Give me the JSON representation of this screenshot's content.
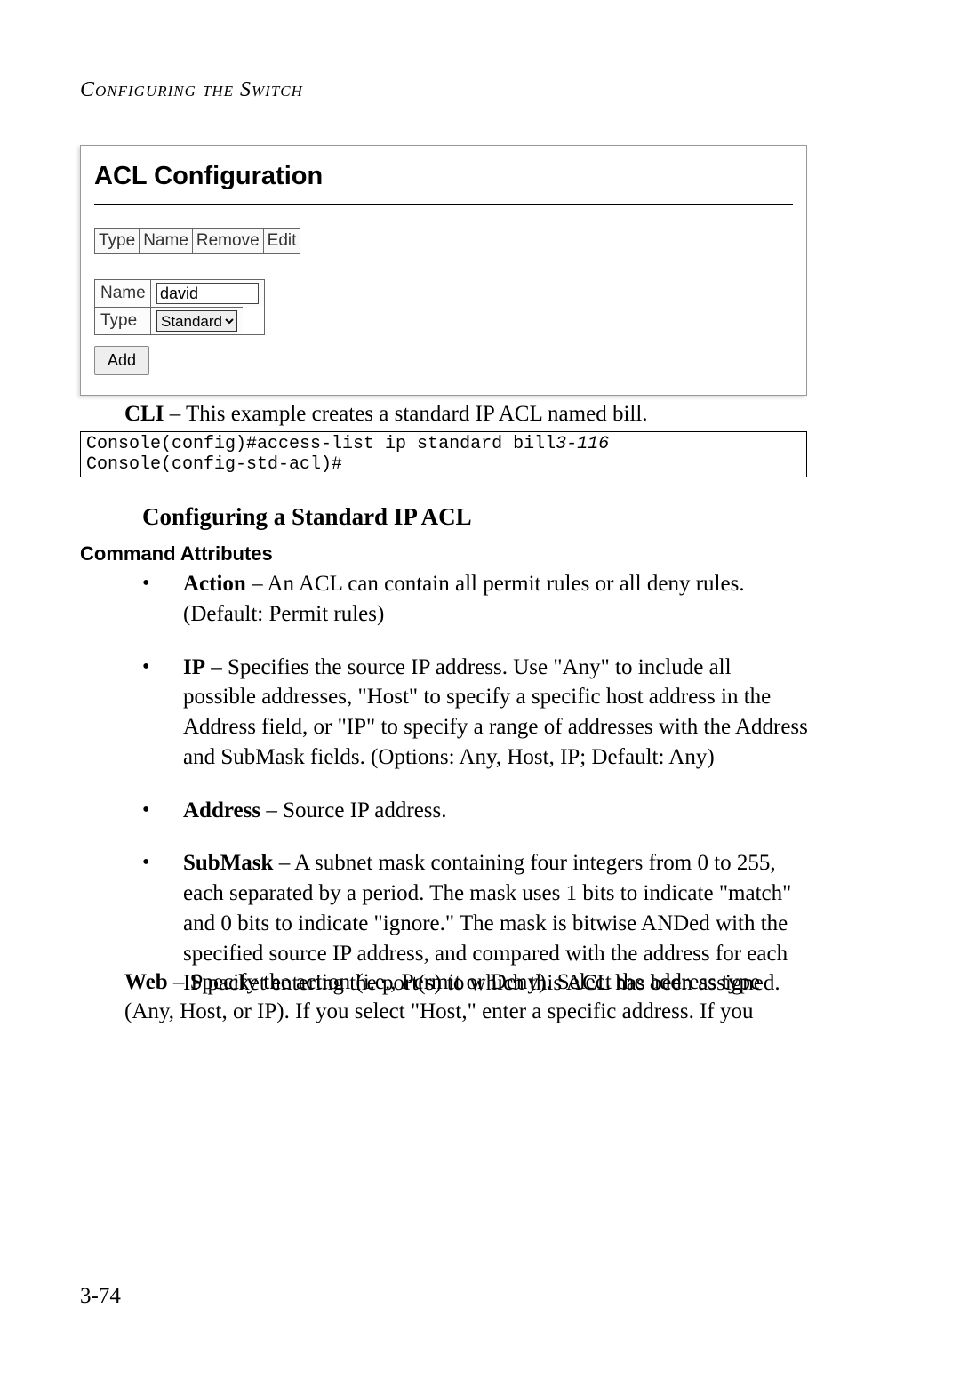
{
  "header": {
    "title": "Configuring the Switch"
  },
  "panel": {
    "title": "ACL Configuration",
    "table_columns": [
      "Type",
      "Name",
      "Remove",
      "Edit"
    ],
    "form": {
      "name_label": "Name",
      "name_value": "david",
      "type_label": "Type",
      "type_value": "Standard",
      "type_options": [
        "Standard"
      ]
    },
    "add_button": "Add"
  },
  "cli": {
    "prefix": "CLI",
    "text": " – This example creates a standard IP ACL named bill."
  },
  "code": {
    "line1_cmd": "Console(config)#access-list ip standard bill",
    "line1_ref": "3-116",
    "line2": "Console(config-std-acl)#"
  },
  "subheading": "Configuring a Standard IP ACL",
  "cmd_attr_label": "Command Attributes",
  "bullets": [
    {
      "term": "Action",
      "text": " – An ACL can contain all permit rules or all deny rules. (Default: Permit rules)"
    },
    {
      "term": "IP",
      "text": " – Specifies the source IP address. Use \"Any\" to include all possible addresses, \"Host\" to specify a specific host address in the Address field, or \"IP\" to specify a range of addresses with the Address and SubMask fields. (Options: Any, Host, IP; Default: Any)"
    },
    {
      "term": "Address",
      "text": " – Source IP address."
    },
    {
      "term": "SubMask",
      "text": " – A subnet mask containing four integers from 0 to 255, each separated by a period. The mask uses 1 bits to indicate \"match\" and 0 bits to indicate \"ignore.\" The mask is bitwise ANDed with the specified source IP address, and compared with the address for each IP packet entering the port(s) to which this ACL has been assigned."
    }
  ],
  "web": {
    "prefix": "Web",
    "text": " – Specify the action (i.e., Permit or Deny). Select the address type (Any, Host, or IP). If you select \"Host,\" enter a specific address. If you"
  },
  "page_number": "3-74"
}
